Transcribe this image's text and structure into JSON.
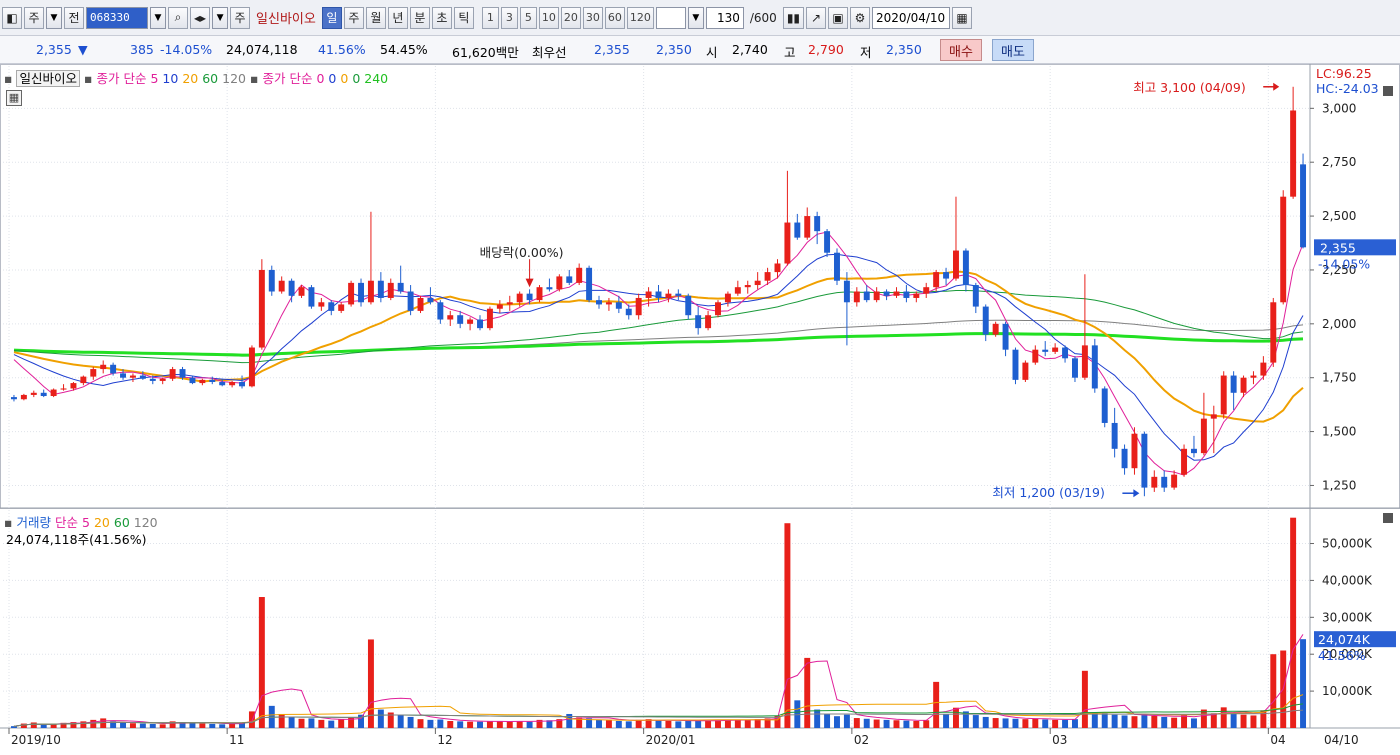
{
  "toolbar": {
    "type_label": "주",
    "type2_label": "전",
    "code_value": "068330",
    "tag_label": "주",
    "stock_name": "일신바이오",
    "periods": [
      "일",
      "주",
      "월",
      "년",
      "분",
      "초",
      "틱"
    ],
    "active_period": "일",
    "minutes": [
      "1",
      "3",
      "5",
      "10",
      "20",
      "30",
      "60",
      "120"
    ],
    "count_value": "130",
    "count_total": "/600",
    "date_value": "2020/04/10"
  },
  "quote": {
    "price": "2,355",
    "change_arrow": "▼",
    "change": "385",
    "change_pct": "-14.05%",
    "volume": "24,074,118",
    "turnover_pct": "41.56%",
    "ratio_pct": "54.45%",
    "amount": "61,620백만",
    "priority_label": "최우선",
    "ask": "2,355",
    "bid": "2,350",
    "open_label": "시",
    "open": "2,740",
    "high_label": "고",
    "high": "2,790",
    "low_label": "저",
    "low": "2,350",
    "buy_label": "매수",
    "sell_label": "매도"
  },
  "price_panel": {
    "legend_name": "일신바이오",
    "ma1_label": "종가 단순",
    "ma1_periods": [
      "5",
      "10",
      "20",
      "60",
      "120"
    ],
    "ma2_label": "종가 단순",
    "ma2_periods": [
      "0",
      "0",
      "0",
      "0",
      "240"
    ],
    "lc_label": "LC:96.25",
    "hc_label": "HC:-24.03",
    "high_annotation": "최고 3,100 (04/09)",
    "low_annotation": "최저 1,200 (03/19)",
    "dividend_annotation": "배당락(0.00%)",
    "current_price_tag": "2,355",
    "current_change_tag": "-14.05%",
    "y_ticks": [
      "3,000",
      "2,750",
      "2,500",
      "2,250",
      "2,000",
      "1,750",
      "1,500",
      "1,250"
    ]
  },
  "volume_panel": {
    "legend_name": "거래량",
    "ma_label": "단순",
    "ma_periods": [
      "5",
      "20",
      "60",
      "120"
    ],
    "summary": "24,074,118주(41.56%)",
    "current_volume_tag": "24,074K",
    "current_pct_tag": "41.56%",
    "y_ticks": [
      "50,000K",
      "40,000K",
      "30,000K",
      "20,000K",
      "10,000K"
    ]
  },
  "x_axis": {
    "labels": [
      "2019/10",
      "11",
      "12",
      "2020/01",
      "02",
      "03",
      "04",
      "04/10"
    ]
  },
  "colors": {
    "up": "#e8201a",
    "down": "#1e5fd0",
    "ma5": "#e0209a",
    "ma10": "#1f3fd0",
    "ma20": "#f0a000",
    "ma60": "#1a9a3a",
    "ma120": "#808080",
    "ma240": "#22e022"
  },
  "chart_data": {
    "type": "candlestick",
    "y_range": [
      1150,
      3150
    ],
    "volume_range_k": [
      0,
      58000
    ],
    "candles": [
      [
        1660,
        1670,
        1640,
        1650,
        500
      ],
      [
        1650,
        1675,
        1645,
        1670,
        1200
      ],
      [
        1670,
        1690,
        1660,
        1680,
        1500
      ],
      [
        1680,
        1695,
        1660,
        1665,
        900
      ],
      [
        1665,
        1700,
        1660,
        1695,
        1100
      ],
      [
        1695,
        1720,
        1690,
        1700,
        1400
      ],
      [
        1700,
        1730,
        1690,
        1725,
        1600
      ],
      [
        1725,
        1760,
        1715,
        1755,
        1800
      ],
      [
        1755,
        1800,
        1740,
        1790,
        2200
      ],
      [
        1790,
        1830,
        1770,
        1810,
        2600
      ],
      [
        1810,
        1820,
        1760,
        1770,
        1800
      ],
      [
        1770,
        1790,
        1740,
        1750,
        1500
      ],
      [
        1750,
        1770,
        1730,
        1760,
        1300
      ],
      [
        1760,
        1780,
        1740,
        1745,
        1200
      ],
      [
        1745,
        1760,
        1720,
        1735,
        1100
      ],
      [
        1735,
        1750,
        1720,
        1745,
        1000
      ],
      [
        1745,
        1800,
        1735,
        1790,
        1800
      ],
      [
        1790,
        1800,
        1740,
        1750,
        1600
      ],
      [
        1750,
        1760,
        1720,
        1725,
        1300
      ],
      [
        1725,
        1745,
        1715,
        1740,
        1200
      ],
      [
        1740,
        1755,
        1720,
        1730,
        1100
      ],
      [
        1730,
        1745,
        1710,
        1715,
        1000
      ],
      [
        1715,
        1735,
        1705,
        1730,
        1200
      ],
      [
        1730,
        1760,
        1700,
        1710,
        1400
      ],
      [
        1710,
        1900,
        1705,
        1890,
        4500
      ],
      [
        1890,
        2300,
        1880,
        2250,
        35500
      ],
      [
        2250,
        2270,
        2130,
        2150,
        6000
      ],
      [
        2150,
        2220,
        2140,
        2200,
        3800
      ],
      [
        2200,
        2210,
        2100,
        2130,
        3000
      ],
      [
        2130,
        2180,
        2120,
        2170,
        2500
      ],
      [
        2170,
        2180,
        2070,
        2080,
        2600
      ],
      [
        2080,
        2120,
        2060,
        2100,
        2200
      ],
      [
        2100,
        2110,
        2040,
        2060,
        2000
      ],
      [
        2060,
        2100,
        2050,
        2090,
        2300
      ],
      [
        2090,
        2200,
        2080,
        2190,
        2800
      ],
      [
        2190,
        2210,
        2080,
        2100,
        3600
      ],
      [
        2100,
        2520,
        2090,
        2200,
        24000
      ],
      [
        2200,
        2240,
        2100,
        2120,
        5000
      ],
      [
        2120,
        2210,
        2110,
        2190,
        4200
      ],
      [
        2190,
        2270,
        2140,
        2150,
        3500
      ],
      [
        2150,
        2180,
        2040,
        2060,
        3000
      ],
      [
        2060,
        2130,
        2050,
        2120,
        2400
      ],
      [
        2120,
        2170,
        2090,
        2100,
        2200
      ],
      [
        2100,
        2110,
        2000,
        2020,
        2300
      ],
      [
        2020,
        2060,
        1990,
        2040,
        1900
      ],
      [
        2040,
        2060,
        1980,
        2000,
        1800
      ],
      [
        2000,
        2030,
        1970,
        2020,
        1700
      ],
      [
        2020,
        2040,
        1970,
        1980,
        1700
      ],
      [
        1980,
        2080,
        1970,
        2070,
        1900
      ],
      [
        2070,
        2110,
        2050,
        2090,
        1800
      ],
      [
        2090,
        2130,
        2060,
        2100,
        1700
      ],
      [
        2100,
        2150,
        2080,
        2140,
        1800
      ],
      [
        2140,
        2160,
        2090,
        2110,
        1700
      ],
      [
        2110,
        2180,
        2100,
        2170,
        2200
      ],
      [
        2170,
        2210,
        2150,
        2160,
        2100
      ],
      [
        2160,
        2230,
        2150,
        2220,
        2400
      ],
      [
        2220,
        2250,
        2180,
        2190,
        3800
      ],
      [
        2190,
        2280,
        2180,
        2260,
        2900
      ],
      [
        2260,
        2270,
        2100,
        2110,
        2600
      ],
      [
        2110,
        2130,
        2070,
        2090,
        2300
      ],
      [
        2090,
        2120,
        2060,
        2100,
        2100
      ],
      [
        2100,
        2130,
        2050,
        2070,
        1900
      ],
      [
        2070,
        2090,
        2020,
        2040,
        1800
      ],
      [
        2040,
        2140,
        2020,
        2120,
        2200
      ],
      [
        2120,
        2170,
        2080,
        2150,
        2400
      ],
      [
        2150,
        2180,
        2100,
        2120,
        2000
      ],
      [
        2120,
        2160,
        2100,
        2140,
        1900
      ],
      [
        2140,
        2160,
        2110,
        2130,
        1800
      ],
      [
        2130,
        2140,
        2020,
        2040,
        1900
      ],
      [
        2040,
        2080,
        1950,
        1980,
        2100
      ],
      [
        1980,
        2060,
        1970,
        2040,
        2000
      ],
      [
        2040,
        2110,
        2030,
        2100,
        2100
      ],
      [
        2100,
        2150,
        2080,
        2140,
        2200
      ],
      [
        2140,
        2200,
        2130,
        2170,
        2300
      ],
      [
        2170,
        2200,
        2140,
        2180,
        2200
      ],
      [
        2180,
        2240,
        2160,
        2200,
        2400
      ],
      [
        2200,
        2260,
        2180,
        2240,
        2600
      ],
      [
        2240,
        2300,
        2210,
        2280,
        3300
      ],
      [
        2280,
        2710,
        2270,
        2470,
        55500
      ],
      [
        2470,
        2510,
        2390,
        2400,
        7500
      ],
      [
        2400,
        2540,
        2390,
        2500,
        19000
      ],
      [
        2500,
        2520,
        2370,
        2430,
        5000
      ],
      [
        2430,
        2440,
        2310,
        2330,
        3800
      ],
      [
        2330,
        2350,
        2180,
        2200,
        3200
      ],
      [
        2200,
        2240,
        1900,
        2100,
        3600
      ],
      [
        2100,
        2170,
        2080,
        2150,
        2700
      ],
      [
        2150,
        2180,
        2100,
        2110,
        2500
      ],
      [
        2110,
        2170,
        2100,
        2150,
        2300
      ],
      [
        2150,
        2160,
        2110,
        2130,
        2200
      ],
      [
        2130,
        2170,
        2120,
        2150,
        2100
      ],
      [
        2150,
        2180,
        2100,
        2120,
        2000
      ],
      [
        2120,
        2150,
        2100,
        2140,
        1900
      ],
      [
        2140,
        2190,
        2120,
        2170,
        2100
      ],
      [
        2170,
        2250,
        2150,
        2240,
        12500
      ],
      [
        2240,
        2260,
        2180,
        2210,
        3800
      ],
      [
        2210,
        2590,
        2200,
        2340,
        5500
      ],
      [
        2340,
        2350,
        2150,
        2180,
        4500
      ],
      [
        2180,
        2190,
        2050,
        2080,
        3500
      ],
      [
        2080,
        2090,
        1920,
        1950,
        3000
      ],
      [
        1950,
        2010,
        1940,
        2000,
        2700
      ],
      [
        2000,
        2010,
        1850,
        1880,
        2600
      ],
      [
        1880,
        1890,
        1720,
        1740,
        2500
      ],
      [
        1740,
        1830,
        1730,
        1820,
        2400
      ],
      [
        1820,
        1900,
        1810,
        1880,
        2600
      ],
      [
        1880,
        1920,
        1850,
        1870,
        2300
      ],
      [
        1870,
        1910,
        1860,
        1890,
        2200
      ],
      [
        1890,
        1900,
        1820,
        1840,
        2200
      ],
      [
        1840,
        1850,
        1730,
        1750,
        2400
      ],
      [
        1750,
        2230,
        1740,
        1900,
        15500
      ],
      [
        1900,
        1930,
        1680,
        1700,
        4200
      ],
      [
        1700,
        1710,
        1520,
        1540,
        4000
      ],
      [
        1540,
        1610,
        1380,
        1420,
        3600
      ],
      [
        1420,
        1440,
        1300,
        1330,
        3400
      ],
      [
        1330,
        1520,
        1300,
        1490,
        3200
      ],
      [
        1490,
        1500,
        1200,
        1240,
        3500
      ],
      [
        1240,
        1320,
        1220,
        1290,
        3300
      ],
      [
        1290,
        1320,
        1220,
        1240,
        3000
      ],
      [
        1240,
        1320,
        1230,
        1300,
        2800
      ],
      [
        1300,
        1440,
        1290,
        1420,
        3500
      ],
      [
        1420,
        1480,
        1380,
        1400,
        2600
      ],
      [
        1400,
        1680,
        1390,
        1560,
        5000
      ],
      [
        1560,
        1620,
        1400,
        1580,
        4000
      ],
      [
        1580,
        1780,
        1560,
        1760,
        5600
      ],
      [
        1760,
        1780,
        1600,
        1680,
        3800
      ],
      [
        1680,
        1760,
        1660,
        1750,
        3600
      ],
      [
        1750,
        1780,
        1720,
        1760,
        3400
      ],
      [
        1760,
        1850,
        1740,
        1820,
        4800
      ],
      [
        1820,
        2120,
        1800,
        2100,
        20000
      ],
      [
        2100,
        2620,
        2090,
        2590,
        21000
      ],
      [
        2590,
        3100,
        2580,
        2990,
        57000
      ],
      [
        2740,
        2790,
        2350,
        2355,
        24074
      ]
    ]
  }
}
